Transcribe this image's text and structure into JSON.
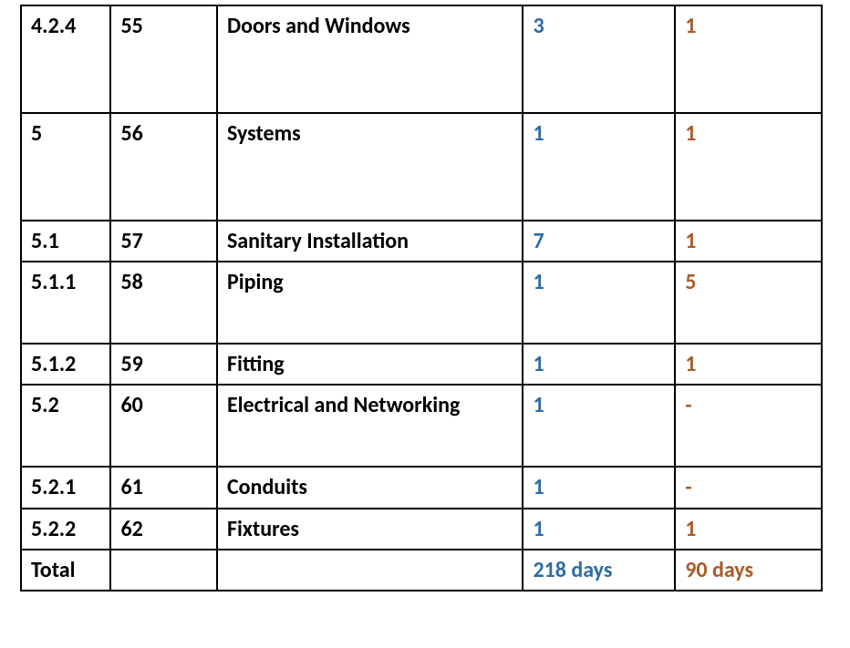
{
  "table": {
    "rows": [
      {
        "c1": "4.2.4",
        "c2": "55",
        "c3": "Doors and Windows",
        "c4": "3",
        "c5": "1",
        "h": "tall"
      },
      {
        "c1": "5",
        "c2": "56",
        "c3": "Systems",
        "c4": "1",
        "c5": "1",
        "h": "tall"
      },
      {
        "c1": "5.1",
        "c2": "57",
        "c3": "Sanitary Installation",
        "c4": "7",
        "c5": "1",
        "h": ""
      },
      {
        "c1": "5.1.1",
        "c2": "58",
        "c3": "Piping",
        "c4": "1",
        "c5": "5",
        "h": "medium"
      },
      {
        "c1": "5.1.2",
        "c2": "59",
        "c3": "Fitting",
        "c4": "1",
        "c5": "1",
        "h": ""
      },
      {
        "c1": "5.2",
        "c2": "60",
        "c3": "Electrical and Networking",
        "c4": "1",
        "c5": "-",
        "h": "medium"
      },
      {
        "c1": "5.2.1",
        "c2": "61",
        "c3": "Conduits",
        "c4": "1",
        "c5": "-",
        "h": ""
      },
      {
        "c1": "5.2.2",
        "c2": "62",
        "c3": "Fixtures",
        "c4": "1",
        "c5": "1",
        "h": ""
      },
      {
        "c1": "Total",
        "c2": "",
        "c3": "",
        "c4": "218 days",
        "c5": "90 days",
        "h": ""
      }
    ]
  }
}
